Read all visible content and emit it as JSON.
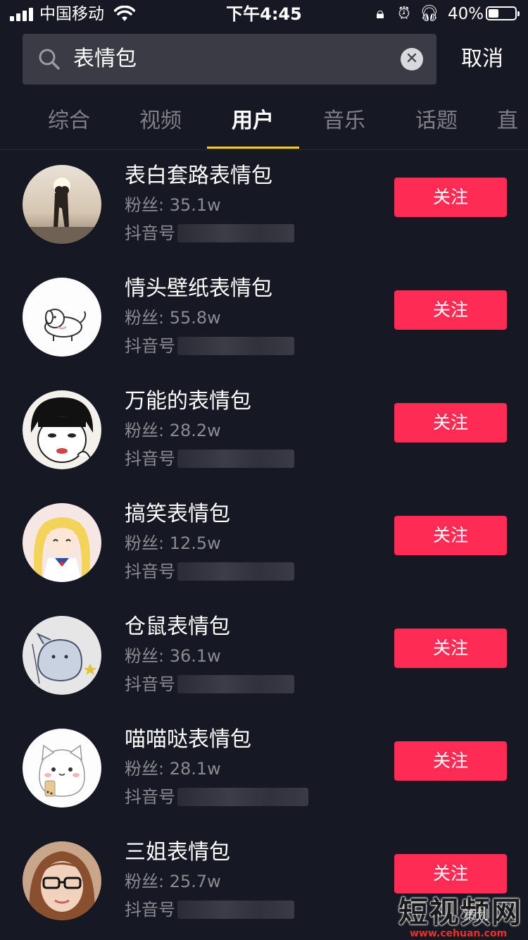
{
  "status_bar": {
    "carrier": "中国移动",
    "time": "下午4:45",
    "battery_text": "40%",
    "battery_level": 0.4
  },
  "search": {
    "query": "表情包",
    "cancel_label": "取消"
  },
  "tabs": [
    {
      "label": "综合",
      "active": false
    },
    {
      "label": "视频",
      "active": false
    },
    {
      "label": "用户",
      "active": true
    },
    {
      "label": "音乐",
      "active": false
    },
    {
      "label": "话题",
      "active": false
    },
    {
      "label": "直",
      "active": false
    }
  ],
  "users": [
    {
      "name": "表白套路表情包",
      "fans": "粉丝: 35.1w",
      "id_label": "抖音号",
      "follow_label": "关注",
      "avatar": "couple-photo"
    },
    {
      "name": "情头壁纸表情包",
      "fans": "粉丝: 55.8w",
      "id_label": "抖音号",
      "follow_label": "关注",
      "avatar": "dog-drawing"
    },
    {
      "name": "万能的表情包",
      "fans": "粉丝: 28.2w",
      "id_label": "抖音号",
      "follow_label": "关注",
      "avatar": "meme-face"
    },
    {
      "name": "搞笑表情包",
      "fans": "粉丝: 12.5w",
      "id_label": "抖音号",
      "follow_label": "关注",
      "avatar": "anime-girl"
    },
    {
      "name": "仓鼠表情包",
      "fans": "粉丝: 36.1w",
      "id_label": "抖音号",
      "follow_label": "关注",
      "avatar": "hamster-sketch"
    },
    {
      "name": "喵喵哒表情包",
      "fans": "粉丝: 28.1w",
      "id_label": "抖音号",
      "follow_label": "关注",
      "avatar": "cat-cartoon"
    },
    {
      "name": "三姐表情包",
      "fans": "粉丝: 25.7w",
      "id_label": "抖音号",
      "follow_label": "关注",
      "avatar": "woman-glasses"
    }
  ],
  "watermark": {
    "title": "短视频网",
    "sub": "策划",
    "url": "www.cehuan.com"
  }
}
